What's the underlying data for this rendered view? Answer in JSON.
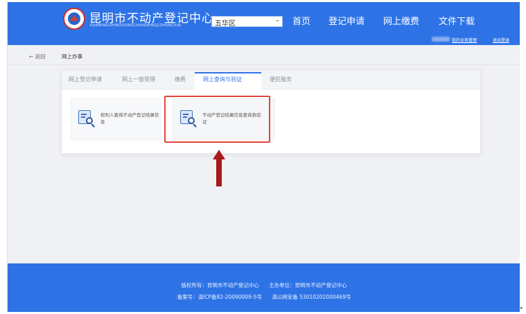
{
  "header": {
    "site_title": "昆明市不动产登记中心",
    "site_subtitle": "KUNMINGSHIBUDONGCHANDENGJIZHONGXIN",
    "district_select": "五华区",
    "nav": [
      "首页",
      "登记申请",
      "网上缴费",
      "文件下载"
    ],
    "user_links": [
      "我的业务管理",
      "退出登录"
    ]
  },
  "breadcrumb": {
    "back": "← 返回",
    "current": "网上办事"
  },
  "tabs": [
    {
      "label": "网上登记申请",
      "active": false
    },
    {
      "label": "网上一窗受理",
      "active": false
    },
    {
      "label": "缴费",
      "active": false
    },
    {
      "label": "网上查询与验证",
      "active": true
    },
    {
      "label": "便民服务",
      "active": false
    }
  ],
  "options": [
    {
      "label": "权利人查询不动产登记结果信息",
      "icon": "document-search-icon"
    },
    {
      "label": "不动产登记结果信息查询表验证",
      "icon": "document-search-icon"
    }
  ],
  "footer": {
    "line1": "版权所有：昆明市不动产登记中心      主办单位：昆明市不动产登记中心",
    "line2": "备案号：滇ICP备82-20090009-5号      滇公网安备 53010202000469号"
  },
  "colors": {
    "brand_blue": "#2e73e6",
    "highlight_red": "#e0463c",
    "arrow_red": "#a81a1a"
  }
}
